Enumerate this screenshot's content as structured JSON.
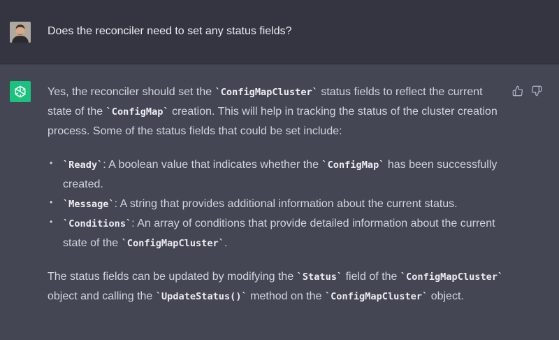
{
  "user_message": {
    "text": "Does the reconciler need to set any status fields?"
  },
  "assistant_message": {
    "intro": {
      "t1": "Yes, the reconciler should set the ",
      "c1": "`ConfigMapCluster`",
      "t2": " status fields to reflect the current state of the ",
      "c2": "`ConfigMap`",
      "t3": " creation. This will help in tracking the status of the cluster creation process. Some of the status fields that could be set include:"
    },
    "bullets": [
      {
        "c1": "`Ready`",
        "t1": ": A boolean value that indicates whether the ",
        "c2": "`ConfigMap`",
        "t2": " has been successfully created."
      },
      {
        "c1": "`Message`",
        "t1": ": A string that provides additional information about the current status.",
        "c2": "",
        "t2": ""
      },
      {
        "c1": "`Conditions`",
        "t1": ": An array of conditions that provide detailed information about the current state of the ",
        "c2": "`ConfigMapCluster`",
        "t2": "."
      }
    ],
    "outro": {
      "t1": "The status fields can be updated by modifying the ",
      "c1": "`Status`",
      "t2": " field of the ",
      "c2": "`ConfigMapCluster`",
      "t3": " object and calling the ",
      "c3": "`UpdateStatus()`",
      "t4": " method on the ",
      "c4": "`ConfigMapCluster`",
      "t5": " object."
    }
  },
  "icons": {
    "thumbs_up": "thumbs-up-icon",
    "thumbs_down": "thumbs-down-icon",
    "assistant_logo": "openai-logo-icon"
  },
  "colors": {
    "user_row_bg": "#343541",
    "assistant_row_bg": "#444654",
    "assistant_avatar_bg": "#19c37d"
  }
}
